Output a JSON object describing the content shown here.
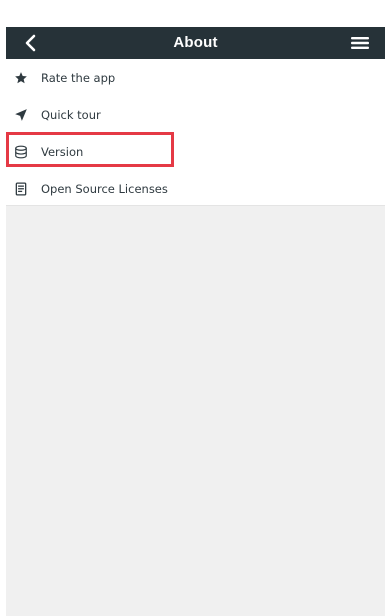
{
  "header": {
    "title": "About",
    "back_icon": "chevron-left-icon",
    "menu_icon": "hamburger-menu-icon",
    "bar_color": "#263238"
  },
  "menu_items": [
    {
      "label": "Rate the app",
      "icon": "star-icon"
    },
    {
      "label": "Quick tour",
      "icon": "send-arrow-icon"
    },
    {
      "label": "Version",
      "icon": "layers-icon",
      "highlighted": true
    },
    {
      "label": "Open Source Licenses",
      "icon": "document-list-icon"
    }
  ],
  "highlight_color": "#e53945"
}
